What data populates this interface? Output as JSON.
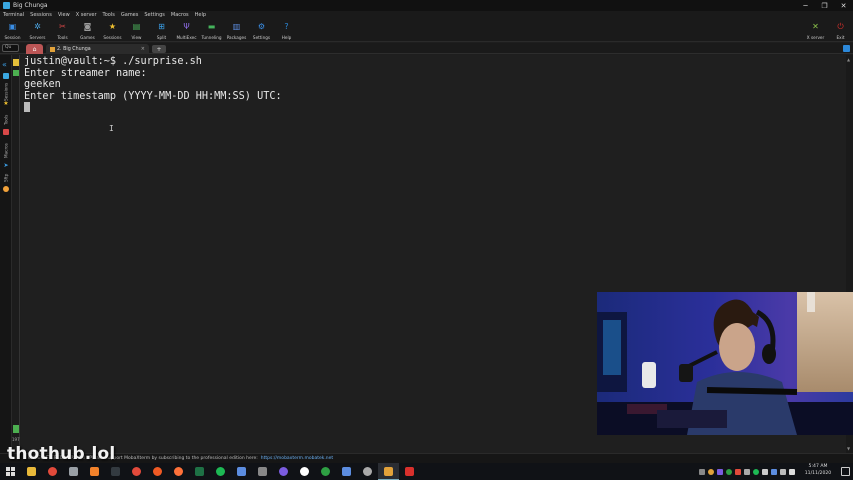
{
  "window": {
    "title": "Big Chunga",
    "minimize": "─",
    "maximize": "❐",
    "close": "✕"
  },
  "menu": [
    "Terminal",
    "Sessions",
    "View",
    "X server",
    "Tools",
    "Games",
    "Settings",
    "Macros",
    "Help"
  ],
  "toolbar": {
    "left": [
      {
        "label": "Session",
        "icon": "session-icon",
        "color": "#3a8ee6",
        "glyph": "▣"
      },
      {
        "label": "Servers",
        "icon": "servers-icon",
        "color": "#4aa3df",
        "glyph": "✲"
      },
      {
        "label": "Tools",
        "icon": "tools-icon",
        "color": "#d94848",
        "glyph": "✂"
      },
      {
        "label": "Games",
        "icon": "games-icon",
        "color": "#9a9a9a",
        "glyph": "◙"
      },
      {
        "label": "Sessions",
        "icon": "star-icon",
        "color": "#f2c230",
        "glyph": "★"
      },
      {
        "label": "View",
        "icon": "view-icon",
        "color": "#4bb05a",
        "glyph": "▤"
      },
      {
        "label": "Split",
        "icon": "split-icon",
        "color": "#3aa0e8",
        "glyph": "⊞"
      },
      {
        "label": "MultiExec",
        "icon": "multiexec-icon",
        "color": "#8a6ae0",
        "glyph": "Ψ"
      },
      {
        "label": "Tunneling",
        "icon": "tunneling-icon",
        "color": "#45b35c",
        "glyph": "▬"
      },
      {
        "label": "Packages",
        "icon": "packages-icon",
        "color": "#5c8de0",
        "glyph": "▥"
      },
      {
        "label": "Settings",
        "icon": "settings-icon",
        "color": "#3a8ee6",
        "glyph": "⚙"
      },
      {
        "label": "Help",
        "icon": "help-icon",
        "color": "#2c88d9",
        "glyph": "?"
      }
    ],
    "right": [
      {
        "label": "X server",
        "icon": "xserver-icon",
        "color": "#8bc34a",
        "glyph": "✕"
      },
      {
        "label": "Exit",
        "icon": "exit-icon",
        "color": "#d9302c",
        "glyph": "⏻"
      }
    ]
  },
  "quick_connect": {
    "placeholder": "Qu"
  },
  "tabs": {
    "home_glyph": "⌂",
    "active_label": "2. Big Chunga",
    "close": "×",
    "add": "+"
  },
  "sidebar": {
    "tabs": [
      "Sessions",
      "Tools",
      "Macros",
      "Sftp"
    ]
  },
  "terminal": {
    "lines": [
      "justin@vault:~$ ./surprise.sh",
      "Enter streamer name:",
      "geeken",
      "Enter timestamp (YYYY-MM-DD HH:MM:SS) UTC:"
    ]
  },
  "gutter": {
    "label": "197"
  },
  "status": {
    "text": "UNREGISTERED VERSION - Please support MobaXterm by subscribing to the professional edition here:",
    "link": "https://mobaxterm.mobatek.net"
  },
  "watermark": "thothub.lol",
  "taskbar": {
    "time": "5:47 AM",
    "date": "11/11/2020",
    "apps": [
      {
        "name": "file-explorer-icon",
        "color": "#e8b93a"
      },
      {
        "name": "chrome-icon",
        "color": "#e24a3b"
      },
      {
        "name": "app-icon",
        "color": "#9aa0a6"
      },
      {
        "name": "sublime-icon",
        "color": "#f2822b"
      },
      {
        "name": "terminal-icon",
        "color": "#333a40"
      },
      {
        "name": "chrome-alt-icon",
        "color": "#e24a3b"
      },
      {
        "name": "brave-icon",
        "color": "#f05a24"
      },
      {
        "name": "firefox-icon",
        "color": "#ff7139"
      },
      {
        "name": "excel-icon",
        "color": "#1e7145"
      },
      {
        "name": "spotify-icon",
        "color": "#1db954"
      },
      {
        "name": "files-icon",
        "color": "#5c8de0"
      },
      {
        "name": "box-icon",
        "color": "#888888"
      },
      {
        "name": "obs-icon",
        "color": "#7b5ce0"
      },
      {
        "name": "player-icon",
        "color": "#ffffff"
      },
      {
        "name": "xbox-icon",
        "color": "#2ea043"
      },
      {
        "name": "monitor-icon",
        "color": "#5c8de0"
      },
      {
        "name": "clock-icon",
        "color": "#aaaaaa"
      },
      {
        "name": "mobaxterm-icon",
        "color": "#e2a23a"
      },
      {
        "name": "calculator-icon",
        "color": "#d9302c"
      }
    ]
  }
}
